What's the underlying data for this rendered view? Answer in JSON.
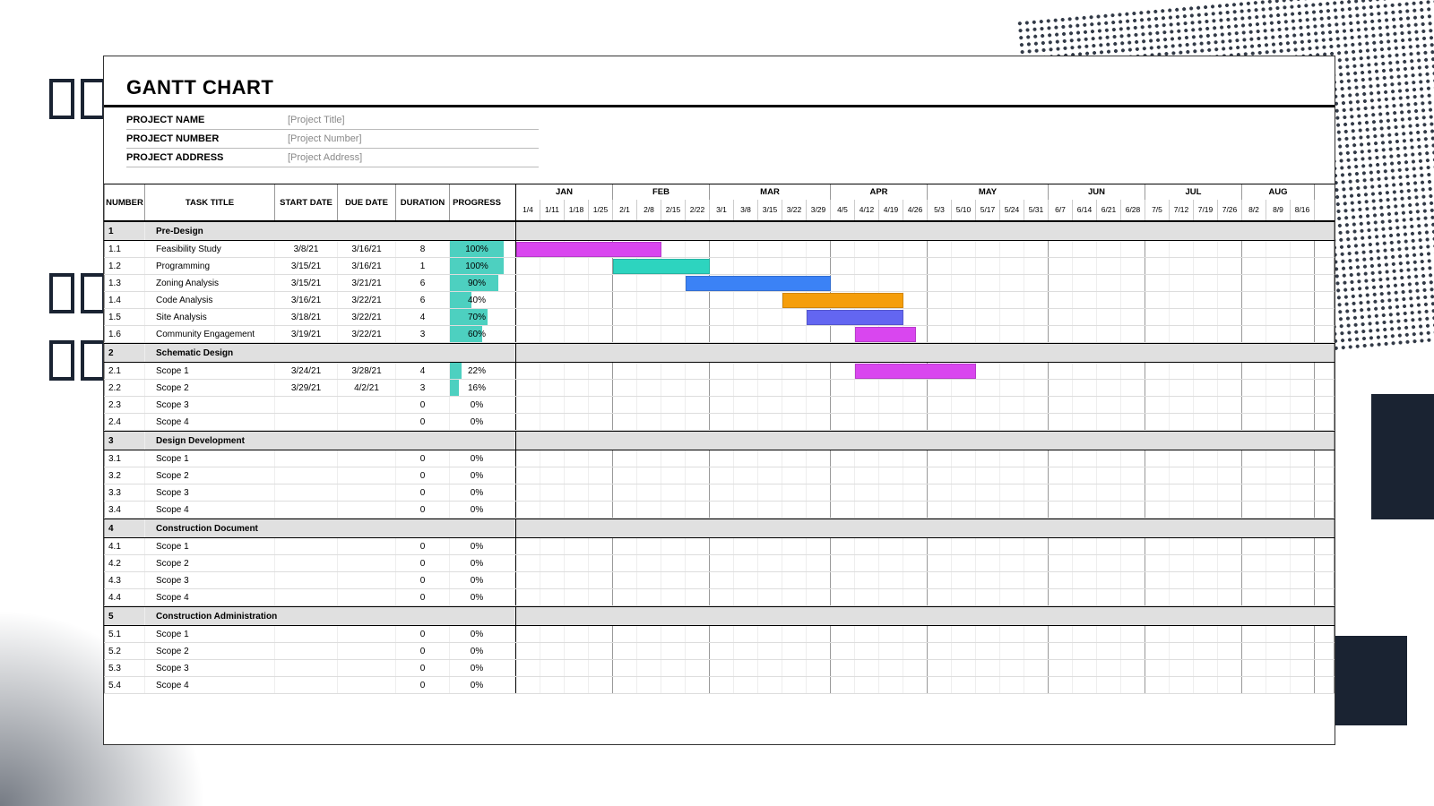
{
  "title": "GANTT CHART",
  "meta": {
    "name_label": "PROJECT NAME",
    "name_value": "[Project Title]",
    "number_label": "PROJECT NUMBER",
    "number_value": "[Project Number]",
    "address_label": "PROJECT ADDRESS",
    "address_value": "[Project Address]"
  },
  "columns": {
    "number": "NUMBER",
    "task": "TASK TITLE",
    "start": "START DATE",
    "due": "DUE DATE",
    "duration": "DURATION",
    "progress": "PROGRESS"
  },
  "months": [
    {
      "label": "JAN",
      "weeks": [
        "1/4",
        "1/11",
        "1/18",
        "1/25"
      ]
    },
    {
      "label": "FEB",
      "weeks": [
        "2/1",
        "2/8",
        "2/15",
        "2/22"
      ]
    },
    {
      "label": "MAR",
      "weeks": [
        "3/1",
        "3/8",
        "3/15",
        "3/22",
        "3/29"
      ]
    },
    {
      "label": "APR",
      "weeks": [
        "4/5",
        "4/12",
        "4/19",
        "4/26"
      ]
    },
    {
      "label": "MAY",
      "weeks": [
        "5/3",
        "5/10",
        "5/17",
        "5/24",
        "5/31"
      ]
    },
    {
      "label": "JUN",
      "weeks": [
        "6/7",
        "6/14",
        "6/21",
        "6/28"
      ]
    },
    {
      "label": "JUL",
      "weeks": [
        "7/5",
        "7/12",
        "7/19",
        "7/26"
      ]
    },
    {
      "label": "AUG",
      "weeks": [
        "8/2",
        "8/9",
        "8/16"
      ]
    }
  ],
  "sections": [
    {
      "num": "1",
      "title": "Pre-Design",
      "tasks": [
        {
          "num": "1.1",
          "title": "Feasibility Study",
          "start": "3/8/21",
          "due": "3/16/21",
          "dur": "8",
          "prog": "100%",
          "bar": {
            "start": 0,
            "span": 6,
            "color": "#d946ef"
          }
        },
        {
          "num": "1.2",
          "title": "Programming",
          "start": "3/15/21",
          "due": "3/16/21",
          "dur": "1",
          "prog": "100%",
          "bar": {
            "start": 4,
            "span": 4,
            "color": "#2dd4bf"
          }
        },
        {
          "num": "1.3",
          "title": "Zoning Analysis",
          "start": "3/15/21",
          "due": "3/21/21",
          "dur": "6",
          "prog": "90%",
          "bar": {
            "start": 7,
            "span": 6,
            "color": "#3b82f6"
          }
        },
        {
          "num": "1.4",
          "title": "Code Analysis",
          "start": "3/16/21",
          "due": "3/22/21",
          "dur": "6",
          "prog": "40%",
          "bar": {
            "start": 11,
            "span": 5,
            "color": "#f59e0b"
          }
        },
        {
          "num": "1.5",
          "title": "Site Analysis",
          "start": "3/18/21",
          "due": "3/22/21",
          "dur": "4",
          "prog": "70%",
          "bar": {
            "start": 12,
            "span": 4,
            "color": "#6366f1"
          }
        },
        {
          "num": "1.6",
          "title": "Community Engagement",
          "start": "3/19/21",
          "due": "3/22/21",
          "dur": "3",
          "prog": "60%",
          "bar": {
            "start": 14,
            "span": 2.5,
            "color": "#d946ef"
          }
        }
      ]
    },
    {
      "num": "2",
      "title": "Schematic Design",
      "tasks": [
        {
          "num": "2.1",
          "title": "Scope 1",
          "start": "3/24/21",
          "due": "3/28/21",
          "dur": "4",
          "prog": "22%",
          "bar": {
            "start": 14,
            "span": 5,
            "color": "#d946ef"
          }
        },
        {
          "num": "2.2",
          "title": "Scope 2",
          "start": "3/29/21",
          "due": "4/2/21",
          "dur": "3",
          "prog": "16%"
        },
        {
          "num": "2.3",
          "title": "Scope 3",
          "start": "",
          "due": "",
          "dur": "0",
          "prog": "0%"
        },
        {
          "num": "2.4",
          "title": "Scope 4",
          "start": "",
          "due": "",
          "dur": "0",
          "prog": "0%"
        }
      ]
    },
    {
      "num": "3",
      "title": "Design Development",
      "tasks": [
        {
          "num": "3.1",
          "title": "Scope 1",
          "start": "",
          "due": "",
          "dur": "0",
          "prog": "0%"
        },
        {
          "num": "3.2",
          "title": "Scope 2",
          "start": "",
          "due": "",
          "dur": "0",
          "prog": "0%"
        },
        {
          "num": "3.3",
          "title": "Scope 3",
          "start": "",
          "due": "",
          "dur": "0",
          "prog": "0%"
        },
        {
          "num": "3.4",
          "title": "Scope 4",
          "start": "",
          "due": "",
          "dur": "0",
          "prog": "0%"
        }
      ]
    },
    {
      "num": "4",
      "title": "Construction Document",
      "tasks": [
        {
          "num": "4.1",
          "title": "Scope 1",
          "start": "",
          "due": "",
          "dur": "0",
          "prog": "0%"
        },
        {
          "num": "4.2",
          "title": "Scope 2",
          "start": "",
          "due": "",
          "dur": "0",
          "prog": "0%"
        },
        {
          "num": "4.3",
          "title": "Scope 3",
          "start": "",
          "due": "",
          "dur": "0",
          "prog": "0%"
        },
        {
          "num": "4.4",
          "title": "Scope 4",
          "start": "",
          "due": "",
          "dur": "0",
          "prog": "0%"
        }
      ]
    },
    {
      "num": "5",
      "title": "Construction Administration",
      "tasks": [
        {
          "num": "5.1",
          "title": "Scope 1",
          "start": "",
          "due": "",
          "dur": "0",
          "prog": "0%"
        },
        {
          "num": "5.2",
          "title": "Scope 2",
          "start": "",
          "due": "",
          "dur": "0",
          "prog": "0%"
        },
        {
          "num": "5.3",
          "title": "Scope 3",
          "start": "",
          "due": "",
          "dur": "0",
          "prog": "0%"
        },
        {
          "num": "5.4",
          "title": "Scope 4",
          "start": "",
          "due": "",
          "dur": "0",
          "prog": "0%"
        }
      ]
    }
  ],
  "chart_data": {
    "type": "gantt",
    "title": "GANTT CHART",
    "x_axis": {
      "unit": "week",
      "start": "2021-01-04",
      "weeks": [
        "1/4",
        "1/11",
        "1/18",
        "1/25",
        "2/1",
        "2/8",
        "2/15",
        "2/22",
        "3/1",
        "3/8",
        "3/15",
        "3/22",
        "3/29",
        "4/5",
        "4/12",
        "4/19",
        "4/26",
        "5/3",
        "5/10",
        "5/17",
        "5/24",
        "5/31",
        "6/7",
        "6/14",
        "6/21",
        "6/28",
        "7/5",
        "7/12",
        "7/19",
        "7/26",
        "8/2",
        "8/9",
        "8/16"
      ]
    },
    "tasks": [
      {
        "id": "1.1",
        "name": "Feasibility Study",
        "start": "2021-03-08",
        "end": "2021-03-16",
        "duration_days": 8,
        "progress_pct": 100,
        "color": "#d946ef",
        "phase": "Pre-Design"
      },
      {
        "id": "1.2",
        "name": "Programming",
        "start": "2021-03-15",
        "end": "2021-03-16",
        "duration_days": 1,
        "progress_pct": 100,
        "color": "#2dd4bf",
        "phase": "Pre-Design"
      },
      {
        "id": "1.3",
        "name": "Zoning Analysis",
        "start": "2021-03-15",
        "end": "2021-03-21",
        "duration_days": 6,
        "progress_pct": 90,
        "color": "#3b82f6",
        "phase": "Pre-Design"
      },
      {
        "id": "1.4",
        "name": "Code Analysis",
        "start": "2021-03-16",
        "end": "2021-03-22",
        "duration_days": 6,
        "progress_pct": 40,
        "color": "#f59e0b",
        "phase": "Pre-Design"
      },
      {
        "id": "1.5",
        "name": "Site Analysis",
        "start": "2021-03-18",
        "end": "2021-03-22",
        "duration_days": 4,
        "progress_pct": 70,
        "color": "#6366f1",
        "phase": "Pre-Design"
      },
      {
        "id": "1.6",
        "name": "Community Engagement",
        "start": "2021-03-19",
        "end": "2021-03-22",
        "duration_days": 3,
        "progress_pct": 60,
        "color": "#d946ef",
        "phase": "Pre-Design"
      },
      {
        "id": "2.1",
        "name": "Scope 1",
        "start": "2021-03-24",
        "end": "2021-03-28",
        "duration_days": 4,
        "progress_pct": 22,
        "color": "#d946ef",
        "phase": "Schematic Design"
      },
      {
        "id": "2.2",
        "name": "Scope 2",
        "start": "2021-03-29",
        "end": "2021-04-02",
        "duration_days": 3,
        "progress_pct": 16,
        "phase": "Schematic Design"
      },
      {
        "id": "2.3",
        "name": "Scope 3",
        "duration_days": 0,
        "progress_pct": 0,
        "phase": "Schematic Design"
      },
      {
        "id": "2.4",
        "name": "Scope 4",
        "duration_days": 0,
        "progress_pct": 0,
        "phase": "Schematic Design"
      },
      {
        "id": "3.1",
        "name": "Scope 1",
        "duration_days": 0,
        "progress_pct": 0,
        "phase": "Design Development"
      },
      {
        "id": "3.2",
        "name": "Scope 2",
        "duration_days": 0,
        "progress_pct": 0,
        "phase": "Design Development"
      },
      {
        "id": "3.3",
        "name": "Scope 3",
        "duration_days": 0,
        "progress_pct": 0,
        "phase": "Design Development"
      },
      {
        "id": "3.4",
        "name": "Scope 4",
        "duration_days": 0,
        "progress_pct": 0,
        "phase": "Design Development"
      },
      {
        "id": "4.1",
        "name": "Scope 1",
        "duration_days": 0,
        "progress_pct": 0,
        "phase": "Construction Document"
      },
      {
        "id": "4.2",
        "name": "Scope 2",
        "duration_days": 0,
        "progress_pct": 0,
        "phase": "Construction Document"
      },
      {
        "id": "4.3",
        "name": "Scope 3",
        "duration_days": 0,
        "progress_pct": 0,
        "phase": "Construction Document"
      },
      {
        "id": "4.4",
        "name": "Scope 4",
        "duration_days": 0,
        "progress_pct": 0,
        "phase": "Construction Document"
      },
      {
        "id": "5.1",
        "name": "Scope 1",
        "duration_days": 0,
        "progress_pct": 0,
        "phase": "Construction Administration"
      },
      {
        "id": "5.2",
        "name": "Scope 2",
        "duration_days": 0,
        "progress_pct": 0,
        "phase": "Construction Administration"
      },
      {
        "id": "5.3",
        "name": "Scope 3",
        "duration_days": 0,
        "progress_pct": 0,
        "phase": "Construction Administration"
      },
      {
        "id": "5.4",
        "name": "Scope 4",
        "duration_days": 0,
        "progress_pct": 0,
        "phase": "Construction Administration"
      }
    ]
  }
}
